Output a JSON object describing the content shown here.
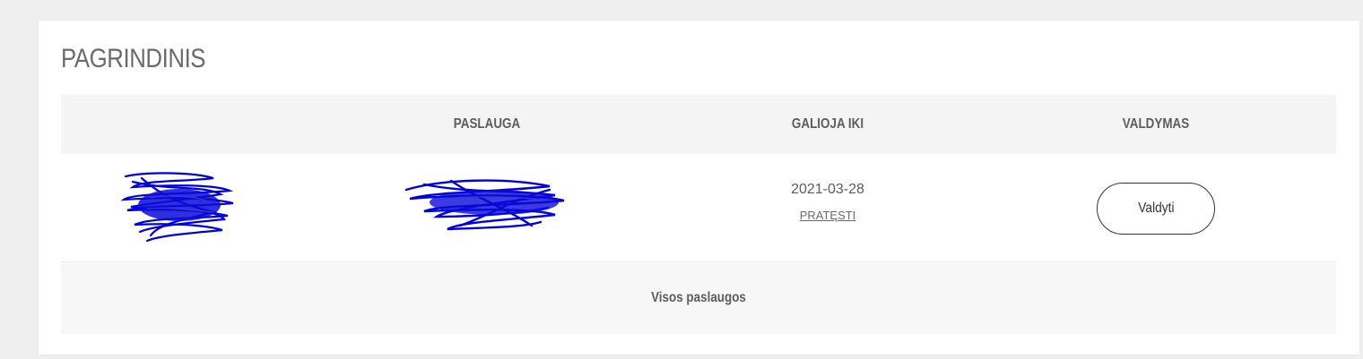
{
  "section": {
    "title": "PAGRINDINIS"
  },
  "table": {
    "columns": [
      "",
      "PASLAUGA",
      "GALIOJA IKI",
      "VALDYMAS"
    ],
    "rows": [
      {
        "logo": "redacted",
        "service": "redacted",
        "valid_until": "2021-03-28",
        "renew_label": "PRATĘSTI",
        "manage_label": "Valdyti"
      }
    ],
    "footer_link": "Visos paslaugos"
  },
  "colors": {
    "redaction_scribble": "#0000dd",
    "header_bg": "#f4f4f4",
    "footer_bg": "#f7f7f7"
  }
}
